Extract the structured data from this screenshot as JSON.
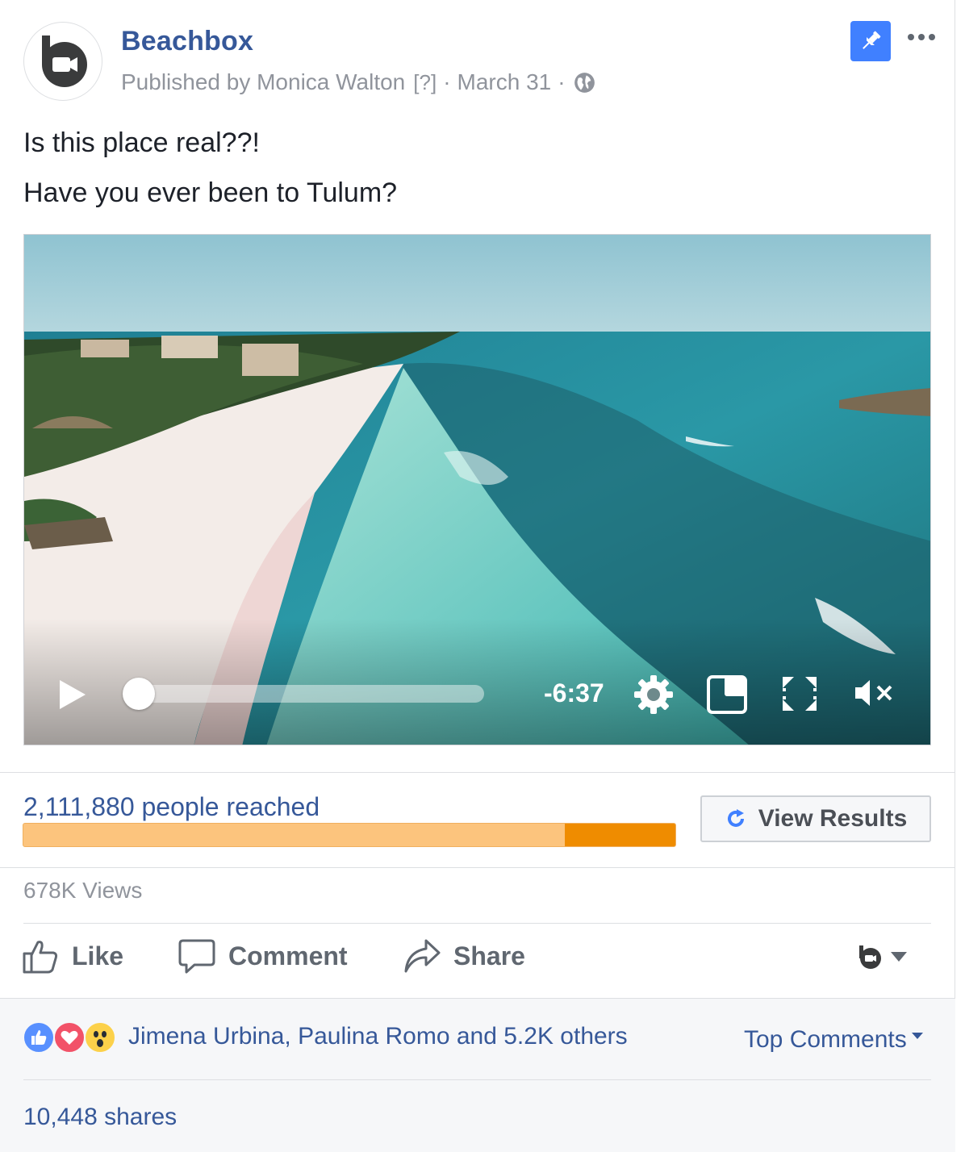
{
  "post": {
    "page_name": "Beachbox",
    "published_by": "Published by Monica Walton",
    "help_marker": "[?]",
    "date": "March 31",
    "separator": "·",
    "text_line1": "Is this place real??!",
    "text_line2": "Have you ever been to Tulum?"
  },
  "video": {
    "remaining_time": "-6:37",
    "progress": 0.0,
    "muted": true
  },
  "insights": {
    "reach_text": "2,111,880 people reached",
    "organic_fraction": 0.83,
    "paid_fraction": 0.17,
    "view_results_label": "View Results",
    "views_text": "678K Views"
  },
  "actions": {
    "like_label": "Like",
    "comment_label": "Comment",
    "share_label": "Share"
  },
  "footer": {
    "reactors_text": "Jimena Urbina, Paulina Romo and 5.2K others",
    "sort_label": "Top Comments",
    "shares_text": "10,448 shares"
  },
  "colors": {
    "link_blue": "#365899",
    "pin_blue": "#4080ff",
    "bar_light": "#fcc47d",
    "bar_dark": "#ef8c00"
  },
  "icons": [
    "camera-logo-icon",
    "globe-icon",
    "pin-icon",
    "more-icon",
    "play-icon",
    "settings-icon",
    "pip-icon",
    "fullscreen-icon",
    "mute-icon",
    "refresh-icon",
    "like-icon",
    "comment-icon",
    "share-icon",
    "like-reaction-icon",
    "love-reaction-icon",
    "wow-reaction-icon",
    "caret-down-icon"
  ]
}
